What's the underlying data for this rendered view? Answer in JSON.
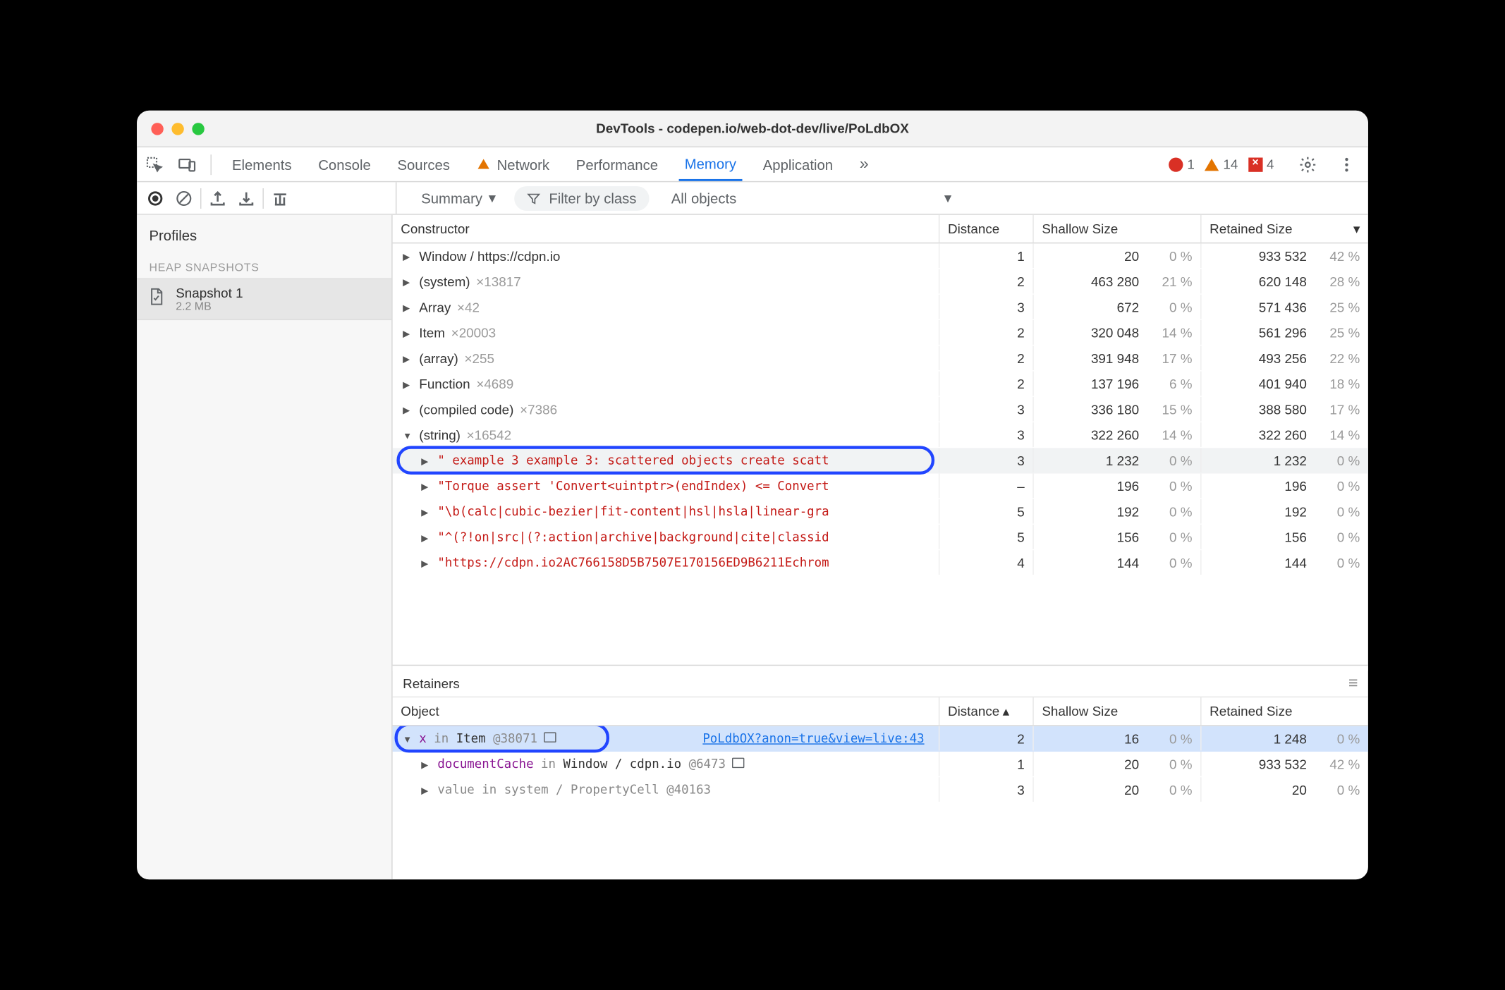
{
  "window_title": "DevTools - codepen.io/web-dot-dev/live/PoLdbOX",
  "tabs": [
    "Elements",
    "Console",
    "Sources",
    "Network",
    "Performance",
    "Memory",
    "Application"
  ],
  "active_tab": "Memory",
  "issues": {
    "errors": 1,
    "warnings": 14,
    "violations": 4
  },
  "toolbar": {
    "view": "Summary",
    "filter_placeholder": "Filter by class",
    "scope": "All objects"
  },
  "sidebar": {
    "profiles_label": "Profiles",
    "heap_label": "HEAP SNAPSHOTS",
    "snapshot": {
      "name": "Snapshot 1",
      "size": "2.2 MB"
    }
  },
  "columns": {
    "constructor": "Constructor",
    "distance": "Distance",
    "shallow": "Shallow Size",
    "retained": "Retained Size"
  },
  "rows": [
    {
      "kind": "obj",
      "indent": 0,
      "open": false,
      "label": "Window / https://cdpn.io",
      "count": "",
      "distance": "1",
      "shallow_v": "20",
      "shallow_p": "0 %",
      "retained_v": "933 532",
      "retained_p": "42 %"
    },
    {
      "kind": "obj",
      "indent": 0,
      "open": false,
      "label": "(system)",
      "count": "×13817",
      "distance": "2",
      "shallow_v": "463 280",
      "shallow_p": "21 %",
      "retained_v": "620 148",
      "retained_p": "28 %"
    },
    {
      "kind": "obj",
      "indent": 0,
      "open": false,
      "label": "Array",
      "count": "×42",
      "distance": "3",
      "shallow_v": "672",
      "shallow_p": "0 %",
      "retained_v": "571 436",
      "retained_p": "25 %"
    },
    {
      "kind": "obj",
      "indent": 0,
      "open": false,
      "label": "Item",
      "count": "×20003",
      "distance": "2",
      "shallow_v": "320 048",
      "shallow_p": "14 %",
      "retained_v": "561 296",
      "retained_p": "25 %"
    },
    {
      "kind": "obj",
      "indent": 0,
      "open": false,
      "label": "(array)",
      "count": "×255",
      "distance": "2",
      "shallow_v": "391 948",
      "shallow_p": "17 %",
      "retained_v": "493 256",
      "retained_p": "22 %"
    },
    {
      "kind": "obj",
      "indent": 0,
      "open": false,
      "label": "Function",
      "count": "×4689",
      "distance": "2",
      "shallow_v": "137 196",
      "shallow_p": "6 %",
      "retained_v": "401 940",
      "retained_p": "18 %"
    },
    {
      "kind": "obj",
      "indent": 0,
      "open": false,
      "label": "(compiled code)",
      "count": "×7386",
      "distance": "3",
      "shallow_v": "336 180",
      "shallow_p": "15 %",
      "retained_v": "388 580",
      "retained_p": "17 %"
    },
    {
      "kind": "obj",
      "indent": 0,
      "open": true,
      "label": "(string)",
      "count": "×16542",
      "distance": "3",
      "shallow_v": "322 260",
      "shallow_p": "14 %",
      "retained_v": "322 260",
      "retained_p": "14 %"
    },
    {
      "kind": "str",
      "indent": 1,
      "open": false,
      "hi": true,
      "label": "\" example 3 example 3: scattered objects create scatt",
      "distance": "3",
      "shallow_v": "1 232",
      "shallow_p": "0 %",
      "retained_v": "1 232",
      "retained_p": "0 %",
      "outline": true
    },
    {
      "kind": "str",
      "indent": 1,
      "open": false,
      "label": "\"Torque assert 'Convert<uintptr>(endIndex) <= Convert",
      "distance": "–",
      "shallow_v": "196",
      "shallow_p": "0 %",
      "retained_v": "196",
      "retained_p": "0 %"
    },
    {
      "kind": "str",
      "indent": 1,
      "open": false,
      "label": "\"\\b(calc|cubic-bezier|fit-content|hsl|hsla|linear-gra",
      "distance": "5",
      "shallow_v": "192",
      "shallow_p": "0 %",
      "retained_v": "192",
      "retained_p": "0 %"
    },
    {
      "kind": "str",
      "indent": 1,
      "open": false,
      "label": "\"^(?!on|src|(?:action|archive|background|cite|classid",
      "distance": "5",
      "shallow_v": "156",
      "shallow_p": "0 %",
      "retained_v": "156",
      "retained_p": "0 %"
    },
    {
      "kind": "str",
      "indent": 1,
      "open": false,
      "label": "\"https://cdpn.io2AC766158D5B7507E170156ED9B6211Echrom",
      "distance": "4",
      "shallow_v": "144",
      "shallow_p": "0 %",
      "retained_v": "144",
      "retained_p": "0 %"
    }
  ],
  "retainers": {
    "title": "Retainers",
    "columns": {
      "object": "Object",
      "distance": "Distance",
      "shallow": "Shallow Size",
      "retained": "Retained Size"
    },
    "rows": [
      {
        "open": true,
        "sel": true,
        "outline": true,
        "prefix": "x",
        "in": " in ",
        "target": "Item",
        "target_gray": false,
        "id": "@38071",
        "box": true,
        "link": "PoLdbOX?anon=true&view=live:43",
        "distance": "2",
        "shallow_v": "16",
        "shallow_p": "0 %",
        "retained_v": "1 248",
        "retained_p": "0 %"
      },
      {
        "open": false,
        "indent": 1,
        "prefix": "documentCache",
        "in": " in ",
        "target": "Window / cdpn.io",
        "target_gray": false,
        "id": "@6473",
        "box": true,
        "link": "",
        "distance": "1",
        "shallow_v": "20",
        "shallow_p": "0 %",
        "retained_v": "933 532",
        "retained_p": "42 %"
      },
      {
        "open": false,
        "indent": 1,
        "prefix": "value",
        "prefix_gray": true,
        "in": " in ",
        "target": "system / PropertyCell",
        "target_gray": true,
        "id": "@40163",
        "box": false,
        "link": "",
        "distance": "3",
        "shallow_v": "20",
        "shallow_p": "0 %",
        "retained_v": "20",
        "retained_p": "0 %"
      }
    ]
  }
}
